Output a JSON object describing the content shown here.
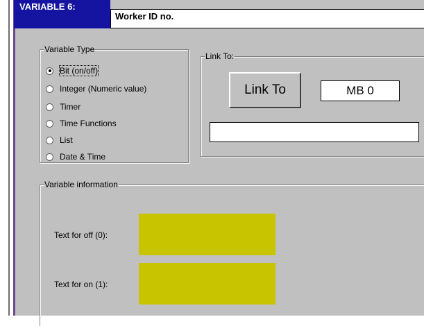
{
  "header": {
    "variable_label": "VARIABLE 6:",
    "variable_name": "Worker ID no."
  },
  "variable_type": {
    "legend": "Variable Type",
    "options": [
      {
        "label": "Bit (on/off)",
        "selected": true
      },
      {
        "label": "Integer (Numeric value)",
        "selected": false
      },
      {
        "label": "Timer",
        "selected": false
      },
      {
        "label": "Time Functions",
        "selected": false
      },
      {
        "label": "List",
        "selected": false
      },
      {
        "label": "Date & Time",
        "selected": false
      }
    ]
  },
  "link_to": {
    "legend": "Link To:",
    "button_label": "Link To",
    "address": "MB  0",
    "field_value": ""
  },
  "variable_info": {
    "legend": "Variable information",
    "off_label": "Text for off (0):",
    "on_label": "Text for on (1):",
    "swatch_color": "#c8c400"
  }
}
